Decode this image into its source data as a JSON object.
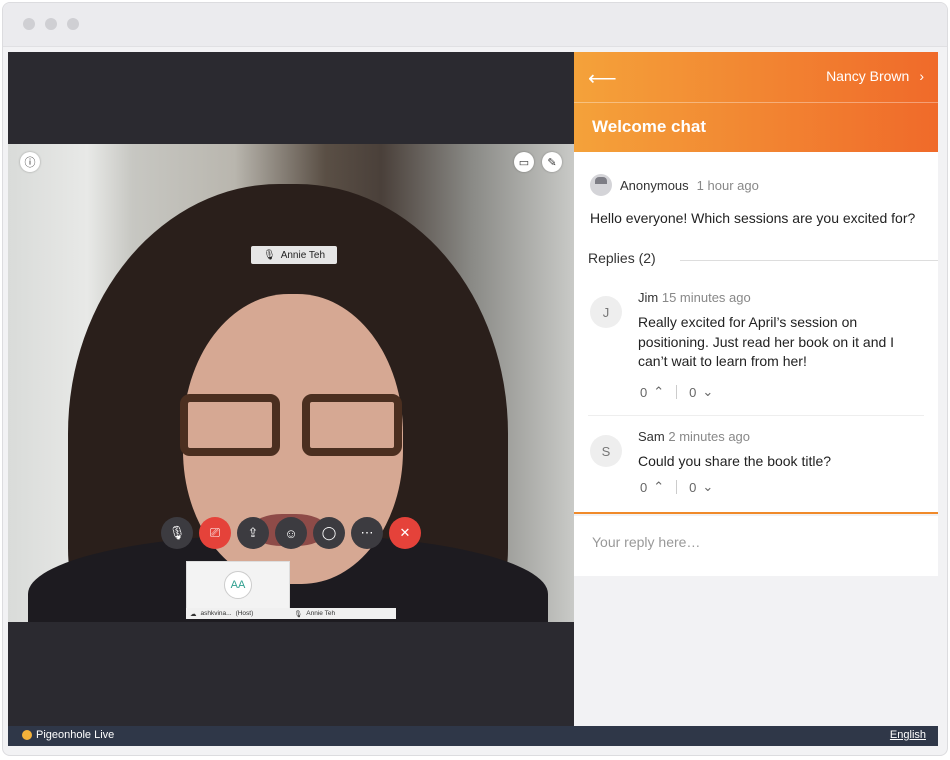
{
  "video": {
    "participant_name": "Annie Teh",
    "thumbnail_initials": "AA",
    "strip_host_name": "ashkvina...",
    "strip_host_role": "(Host)",
    "strip_participant": "Annie Teh"
  },
  "chat": {
    "back_icon": "arrow-left-icon",
    "user_name": "Nancy Brown",
    "title": "Welcome chat",
    "post": {
      "author": "Anonymous",
      "time": "1 hour ago",
      "text": "Hello everyone! Which sessions are you excited for?"
    },
    "replies_heading": "Replies (2)",
    "replies": [
      {
        "initial": "J",
        "author": "Jim",
        "time": "15 minutes ago",
        "text": "Really excited for April’s session on positioning. Just read her book on it and I can’t wait to learn from her!",
        "up": "0",
        "down": "0"
      },
      {
        "initial": "S",
        "author": "Sam",
        "time": "2 minutes ago",
        "text": "Could you share the book title?",
        "up": "0",
        "down": "0"
      }
    ],
    "reply_placeholder": "Your reply here…"
  },
  "footer": {
    "brand": "Pigeonhole Live",
    "language": "English"
  },
  "colors": {
    "accent_start": "#f4a23a",
    "accent_end": "#f06a2a",
    "end_call_red": "#e5423a",
    "footer_bg": "#2f3748"
  }
}
